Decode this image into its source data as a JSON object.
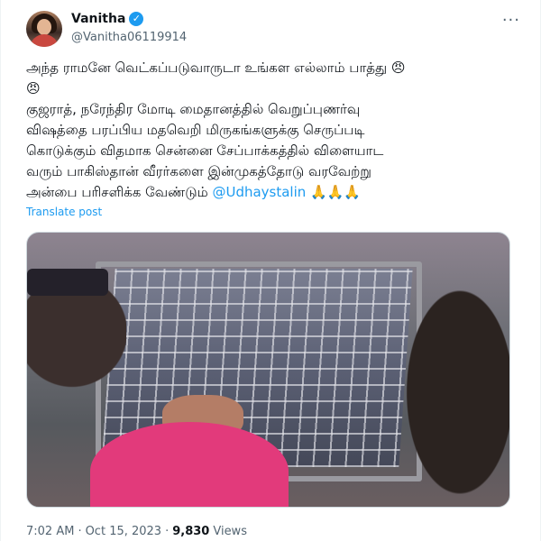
{
  "author": {
    "display_name": "Vanitha",
    "handle": "@Vanitha06119914",
    "verified_icon": "✓"
  },
  "more_icon": "···",
  "tweet": {
    "text": "அந்த ராமனே வெட்கப்படுவாருடா உங்கள எல்லாம் பாத்து 😠\n😠\nகுஜராத், நரேந்திர மோடி மைதானத்தில் வெறுப்புணர்வு\nவிஷத்தை பரப்பிய மதவெறி மிருகங்களுக்கு செருப்படி\nகொடுக்கும் விதமாக சென்னை சேப்பாக்கத்தில் விளையாட\nவரும் பாகிஸ்தான் வீரர்களை இன்முகத்தோடு வரவேற்று\nஅன்பை பரிசளிக்க வேண்டும் ",
    "mention": "@Udhaystalin",
    "trailing_emoji": " 🙏🙏🙏"
  },
  "translate_label": "Translate post",
  "meta": {
    "time": "7:02 AM",
    "separator1": "·",
    "date": "Oct 15, 2023",
    "separator2": "·",
    "views_count": "9,830",
    "views_label": "Views"
  },
  "colors": {
    "accent": "#1d9bf0",
    "text": "#0f1419",
    "secondary": "#536471"
  }
}
